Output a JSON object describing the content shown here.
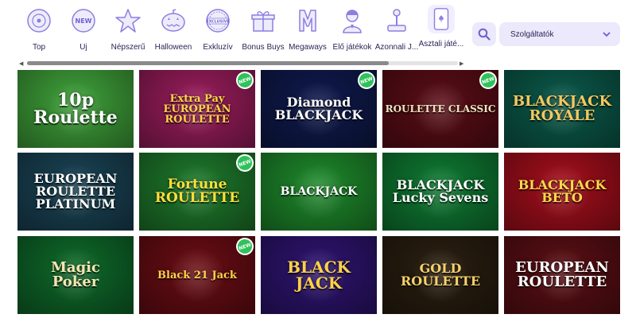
{
  "categories": [
    {
      "label": "Top",
      "icon": "top-icon"
    },
    {
      "label": "Új",
      "icon": "new-icon"
    },
    {
      "label": "Népszerű",
      "icon": "star-icon"
    },
    {
      "label": "Halloween",
      "icon": "pumpkin-icon"
    },
    {
      "label": "Exkluzív",
      "icon": "exclusive-icon"
    },
    {
      "label": "Bonus Buys",
      "icon": "gift-icon"
    },
    {
      "label": "Megaways",
      "icon": "megaways-icon"
    },
    {
      "label": "Élő játékok",
      "icon": "live-dealer-icon"
    },
    {
      "label": "Azonnali J...",
      "icon": "joystick-icon"
    },
    {
      "label": "Asztali játé...",
      "icon": "cards-icon",
      "active": true
    }
  ],
  "search": {
    "icon": "search-icon"
  },
  "provider_select": {
    "value": "Szolgáltatók",
    "icon": "chevron-down-icon"
  },
  "scrollbar": {
    "position": 0.0,
    "visible_fraction": 0.84
  },
  "colors": {
    "accent": "#8b7fe0",
    "text": "#2b2456",
    "new_badge": "#2fc25b",
    "control_bg": "#ebe9fb"
  },
  "new_badge_label": "NEW",
  "games": [
    {
      "title": "10p\nRoulette",
      "new": false,
      "bg": "#3fa23a",
      "fg": "#ffffff"
    },
    {
      "title": "Extra Pay\nEUROPEAN\nROULETTE",
      "new": true,
      "bg": "#9a1d5c",
      "fg": "#ffd24a"
    },
    {
      "title": "Diamond\nBLACKJACK",
      "new": true,
      "bg": "#0f1a4d",
      "fg": "#ffffff"
    },
    {
      "title": "ROULETTE CLASSIC",
      "new": true,
      "bg": "#5a0d16",
      "fg": "#f2e2c0"
    },
    {
      "title": "BLACKJACK\nROYALE",
      "new": false,
      "bg": "#0b5a4b",
      "fg": "#f3c860"
    },
    {
      "title": "EUROPEAN\nROULETTE\nPLATINUM",
      "new": false,
      "bg": "#1a4455",
      "fg": "#ffffff"
    },
    {
      "title": "Fortune\nROULETTE",
      "new": true,
      "bg": "#1e7a2c",
      "fg": "#ffdf3a"
    },
    {
      "title": "BLACKJACK",
      "new": false,
      "bg": "#1e8a2c",
      "fg": "#ffffff"
    },
    {
      "title": "BLACKJACK\nLucky Sevens",
      "new": false,
      "bg": "#0f7b33",
      "fg": "#ffffff"
    },
    {
      "title": "BLACKJACK\nBETO",
      "new": false,
      "bg": "#a50f1c",
      "fg": "#ffd94a"
    },
    {
      "title": "Magic\nPoker",
      "new": false,
      "bg": "#0e6a2a",
      "fg": "#f2e6b0"
    },
    {
      "title": "Black 21 Jack",
      "new": true,
      "bg": "#6a0d14",
      "fg": "#ffd24a"
    },
    {
      "title": "BLACK\nJACK",
      "new": false,
      "bg": "#2e1470",
      "fg": "#ffd24a"
    },
    {
      "title": "GOLD\nROULETTE",
      "new": false,
      "bg": "#2a1e10",
      "fg": "#f7d16a"
    },
    {
      "title": "EUROPEAN\nROULETTE",
      "new": false,
      "bg": "#5a0f14",
      "fg": "#ffffff"
    }
  ]
}
